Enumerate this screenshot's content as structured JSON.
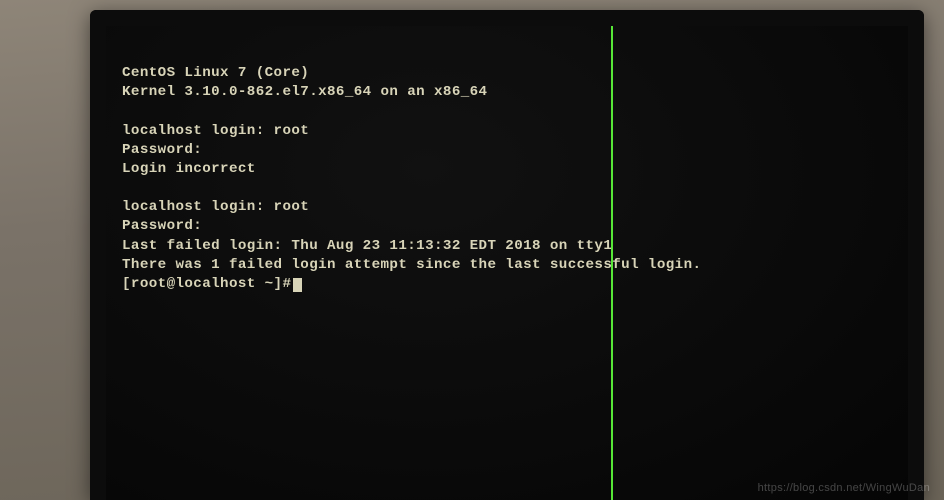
{
  "terminal": {
    "os_line": "CentOS Linux 7 (Core)",
    "kernel_line": "Kernel 3.10.0-862.el7.x86_64 on an x86_64",
    "attempt1": {
      "login_prompt": "localhost login: root",
      "password_prompt": "Password:",
      "result": "Login incorrect"
    },
    "attempt2": {
      "login_prompt": "localhost login: root",
      "password_prompt": "Password:",
      "last_failed": "Last failed login: Thu Aug 23 11:13:32 EDT 2018 on tty1",
      "failed_count_msg": "There was 1 failed login attempt since the last successful login.",
      "shell_prompt": "[root@localhost ~]#"
    }
  },
  "watermark": "https://blog.csdn.net/WingWuDan"
}
